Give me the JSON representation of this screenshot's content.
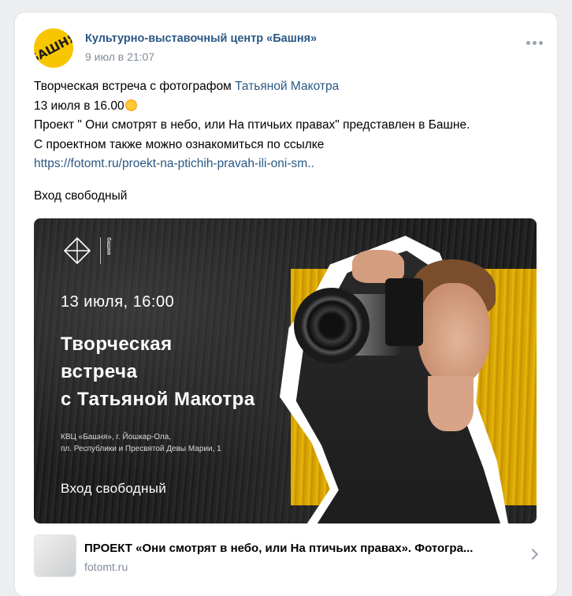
{
  "post": {
    "author": "Культурно-выставочный центр «Башня»",
    "avatar_text": "БАШНЯ",
    "date": "9 июл в 21:07",
    "line1_prefix": "Творческая встреча с фотографом ",
    "line1_link": "Татьяной Макотра",
    "line2": "13 июля в 16.00",
    "line3": "Проект \" Они смотрят в небо, или На птичьих правах\" представлен в Башне.",
    "line4": "С проектном также можно ознакомиться по ссылке",
    "url": "https://fotomt.ru/proekt-na-ptichih-pravah-ili-oni-sm..",
    "free": "Вход свободный"
  },
  "poster": {
    "logo_text": "башня",
    "date": "13 июля, 16:00",
    "title": "Творческая\nвстреча\nс Татьяной Макотра",
    "address": "КВЦ «Башня», г. Йошкар-Ола,\nпл. Республики и Пресвятой Девы Марии, 1",
    "free": "Вход свободный"
  },
  "link_card": {
    "title": "ПРОЕКТ «Они смотрят в небо, или На птичьих правах». Фотогра...",
    "domain": "fotomt.ru"
  },
  "icons": {
    "more": "more-horizontal-icon",
    "sun": "sun-emoji-icon",
    "chevron": "chevron-right-icon"
  },
  "colors": {
    "link": "#2a5885",
    "meta": "#818c99",
    "brand_yellow": "#f7c600"
  }
}
